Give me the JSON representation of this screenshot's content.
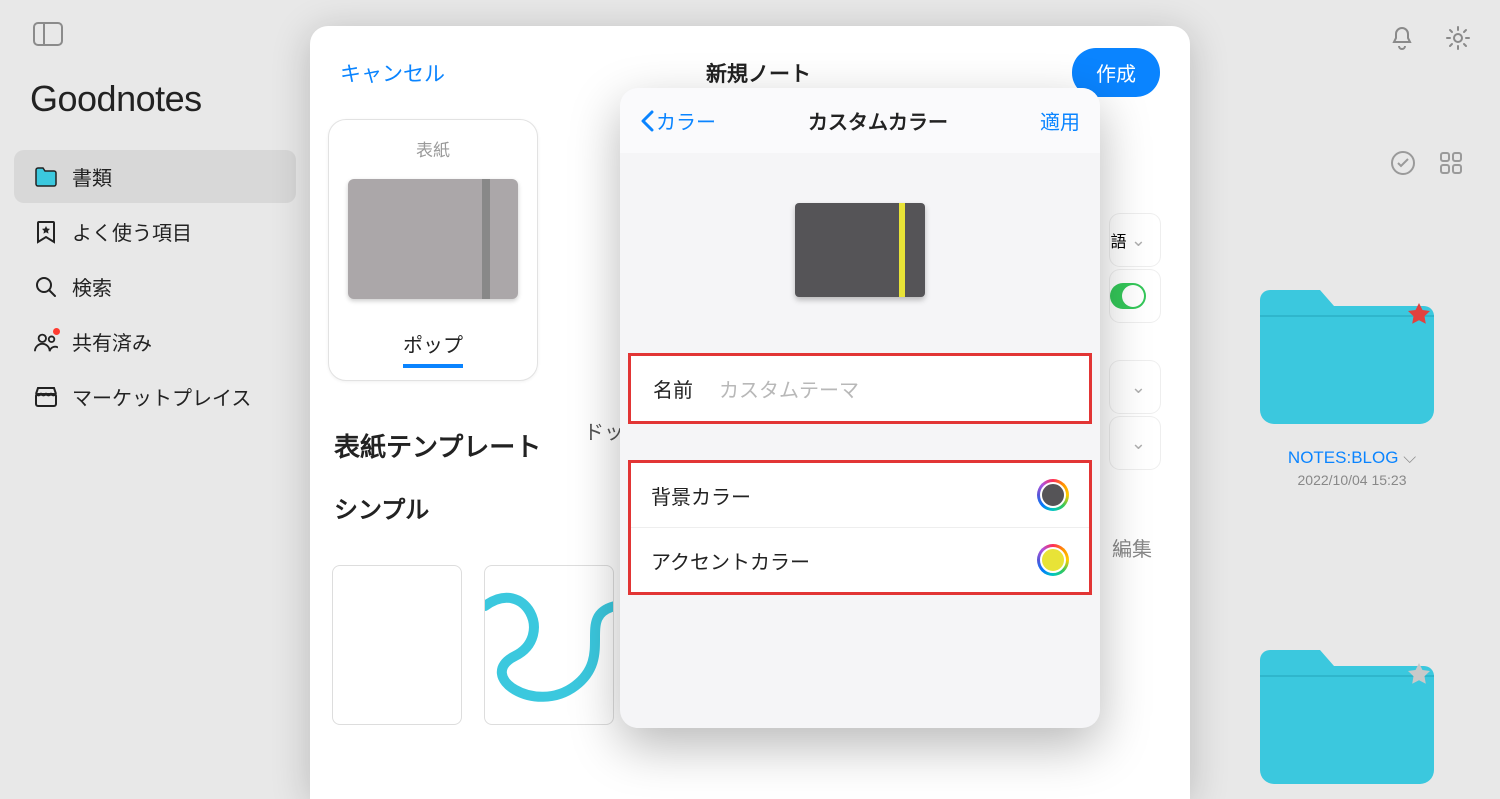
{
  "app_title": "Goodnotes",
  "sidebar": {
    "items": [
      {
        "label": "書類"
      },
      {
        "label": "よく使う項目"
      },
      {
        "label": "検索"
      },
      {
        "label": "共有済み"
      },
      {
        "label": "マーケットプレイス"
      }
    ]
  },
  "folders": [
    {
      "name": "NOTES:BLOG",
      "date": "2022/10/04 15:23"
    }
  ],
  "modal": {
    "cancel": "キャンセル",
    "title": "新規ノート",
    "create": "作成",
    "tab_cover_label": "表紙",
    "tab_pop": "ポップ",
    "tab_dot_prefix": "ドッ",
    "section_templates": "表紙テンプレート",
    "subsection_simple": "シンプル",
    "edit": "編集",
    "peek_lang_suffix": "語"
  },
  "popover": {
    "back": "カラー",
    "title": "カスタムカラー",
    "apply": "適用",
    "name_label": "名前",
    "name_placeholder": "カスタムテーマ",
    "bg_color": "背景カラー",
    "accent_color": "アクセントカラー",
    "bg_swatch": "#555457",
    "accent_swatch": "#e8e337"
  }
}
